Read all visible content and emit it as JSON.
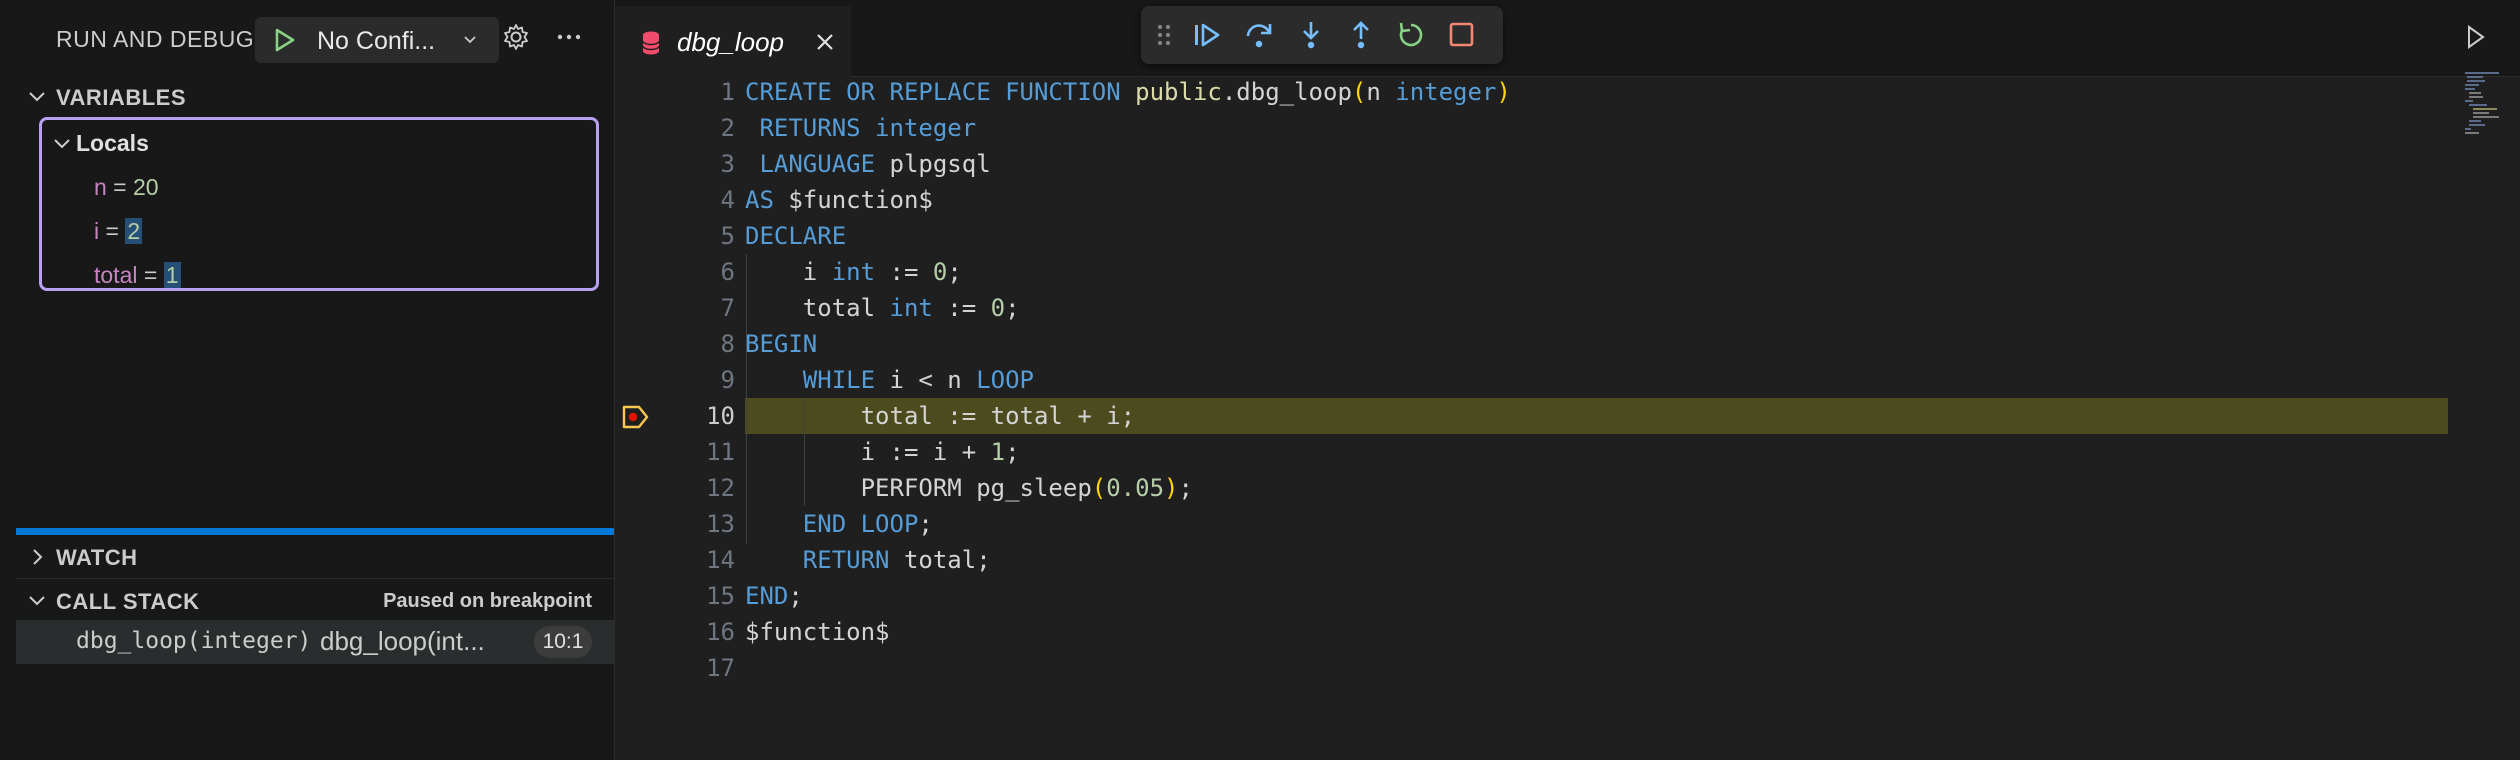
{
  "sidebar": {
    "title": "RUN AND DEBUG",
    "config_label": "No Confi...",
    "variables": {
      "header": "VARIABLES",
      "scope": "Locals",
      "items": [
        {
          "name": "n",
          "value": "20"
        },
        {
          "name": "i",
          "value": "2"
        },
        {
          "name": "total",
          "value": "1"
        }
      ]
    },
    "watch": {
      "header": "WATCH"
    },
    "call_stack": {
      "header": "CALL STACK",
      "status": "Paused on breakpoint",
      "frames": [
        {
          "function": "dbg_loop(integer)",
          "source": "dbg_loop(int...",
          "position": "10:1"
        }
      ]
    }
  },
  "editor": {
    "tab": {
      "name": "dbg_loop"
    },
    "current_line": 10,
    "line_numbers": [
      "1",
      "2",
      "3",
      "4",
      "5",
      "6",
      "7",
      "8",
      "9",
      "10",
      "11",
      "12",
      "13",
      "14",
      "15",
      "16",
      "17"
    ],
    "lines": [
      [
        {
          "t": "CREATE OR REPLACE FUNCTION ",
          "c": "kw"
        },
        {
          "t": "public",
          "c": "fnc"
        },
        {
          "t": ".",
          "c": "plain"
        },
        {
          "t": "dbg_loop",
          "c": "plain"
        },
        {
          "t": "(",
          "c": "par"
        },
        {
          "t": "n ",
          "c": "plain"
        },
        {
          "t": "integer",
          "c": "kw"
        },
        {
          "t": ")",
          "c": "par"
        }
      ],
      [
        {
          "t": " RETURNS ",
          "c": "kw"
        },
        {
          "t": "integer",
          "c": "kw"
        }
      ],
      [
        {
          "t": " LANGUAGE ",
          "c": "kw"
        },
        {
          "t": "plpgsql",
          "c": "plain"
        }
      ],
      [
        {
          "t": "AS ",
          "c": "kw"
        },
        {
          "t": "$function$",
          "c": "plain"
        }
      ],
      [
        {
          "t": "DECLARE",
          "c": "kw"
        }
      ],
      [
        {
          "t": "    i ",
          "c": "plain"
        },
        {
          "t": "int",
          "c": "kw"
        },
        {
          "t": " := ",
          "c": "plain"
        },
        {
          "t": "0",
          "c": "num"
        },
        {
          "t": ";",
          "c": "plain"
        }
      ],
      [
        {
          "t": "    total ",
          "c": "plain"
        },
        {
          "t": "int",
          "c": "kw"
        },
        {
          "t": " := ",
          "c": "plain"
        },
        {
          "t": "0",
          "c": "num"
        },
        {
          "t": ";",
          "c": "plain"
        }
      ],
      [
        {
          "t": "BEGIN",
          "c": "kw"
        }
      ],
      [
        {
          "t": "    ",
          "c": "plain"
        },
        {
          "t": "WHILE",
          "c": "kw"
        },
        {
          "t": " i < n ",
          "c": "plain"
        },
        {
          "t": "LOOP",
          "c": "kw"
        }
      ],
      [
        {
          "t": "        total := total + i;",
          "c": "plain"
        }
      ],
      [
        {
          "t": "        i := i + ",
          "c": "plain"
        },
        {
          "t": "1",
          "c": "num"
        },
        {
          "t": ";",
          "c": "plain"
        }
      ],
      [
        {
          "t": "        PERFORM pg_sleep",
          "c": "plain"
        },
        {
          "t": "(",
          "c": "par"
        },
        {
          "t": "0.05",
          "c": "num"
        },
        {
          "t": ")",
          "c": "par"
        },
        {
          "t": ";",
          "c": "plain"
        }
      ],
      [
        {
          "t": "    ",
          "c": "plain"
        },
        {
          "t": "END LOOP",
          "c": "kw"
        },
        {
          "t": ";",
          "c": "plain"
        }
      ],
      [
        {
          "t": "    ",
          "c": "plain"
        },
        {
          "t": "RETURN",
          "c": "kw"
        },
        {
          "t": " total;",
          "c": "plain"
        }
      ],
      [
        {
          "t": "END",
          "c": "kw"
        },
        {
          "t": ";",
          "c": "plain"
        }
      ],
      [
        {
          "t": "$function$",
          "c": "plain"
        }
      ],
      [
        {
          "t": "",
          "c": "plain"
        }
      ]
    ]
  },
  "colors": {
    "accent": "#0078d4",
    "focus_border": "#b9a0f0",
    "current_line": "#4b4b1e",
    "breakpoint": "#f9c74f"
  }
}
